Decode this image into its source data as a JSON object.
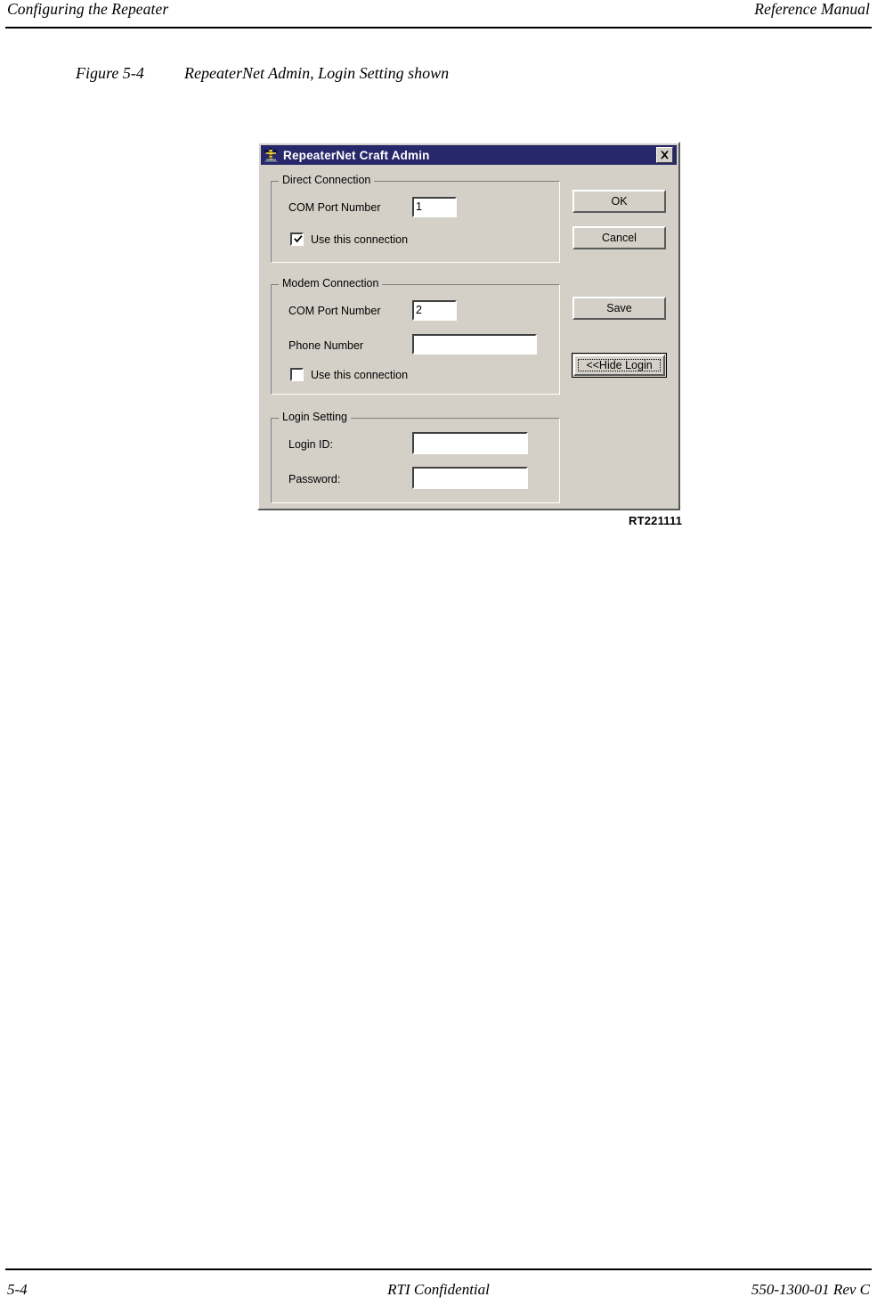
{
  "page": {
    "header_left": "Configuring the Repeater",
    "header_right": "Reference Manual",
    "footer_left": "5-4",
    "footer_center": "RTI Confidential",
    "footer_right": "550-1300-01 Rev C"
  },
  "figure": {
    "number": "Figure 5-4",
    "caption": "RepeaterNet Admin, Login Setting shown",
    "figure_id": "RT221111"
  },
  "dialog": {
    "title": "RepeaterNet Craft Admin",
    "close_label": "×",
    "colors": {
      "titlebar": "#27286B",
      "face": "#D4D0C8",
      "shadow": "#5A5A5A",
      "highlight": "#FFFFFF",
      "text": "#000000"
    },
    "direct_connection": {
      "legend": "Direct Connection",
      "com_port_label": "COM Port Number",
      "com_port_value": "1",
      "use_connection_label": "Use this connection",
      "use_connection_checked": true
    },
    "modem_connection": {
      "legend": "Modem Connection",
      "com_port_label": "COM Port Number",
      "com_port_value": "2",
      "phone_label": "Phone Number",
      "phone_value": "",
      "use_connection_label": "Use this connection",
      "use_connection_checked": false
    },
    "login_setting": {
      "legend": "Login Setting",
      "login_id_label": "Login ID:",
      "login_id_value": "",
      "password_label": "Password:",
      "password_value": ""
    },
    "buttons": {
      "ok": "OK",
      "cancel": "Cancel",
      "save": "Save",
      "hide_login": "<<Hide Login"
    }
  }
}
